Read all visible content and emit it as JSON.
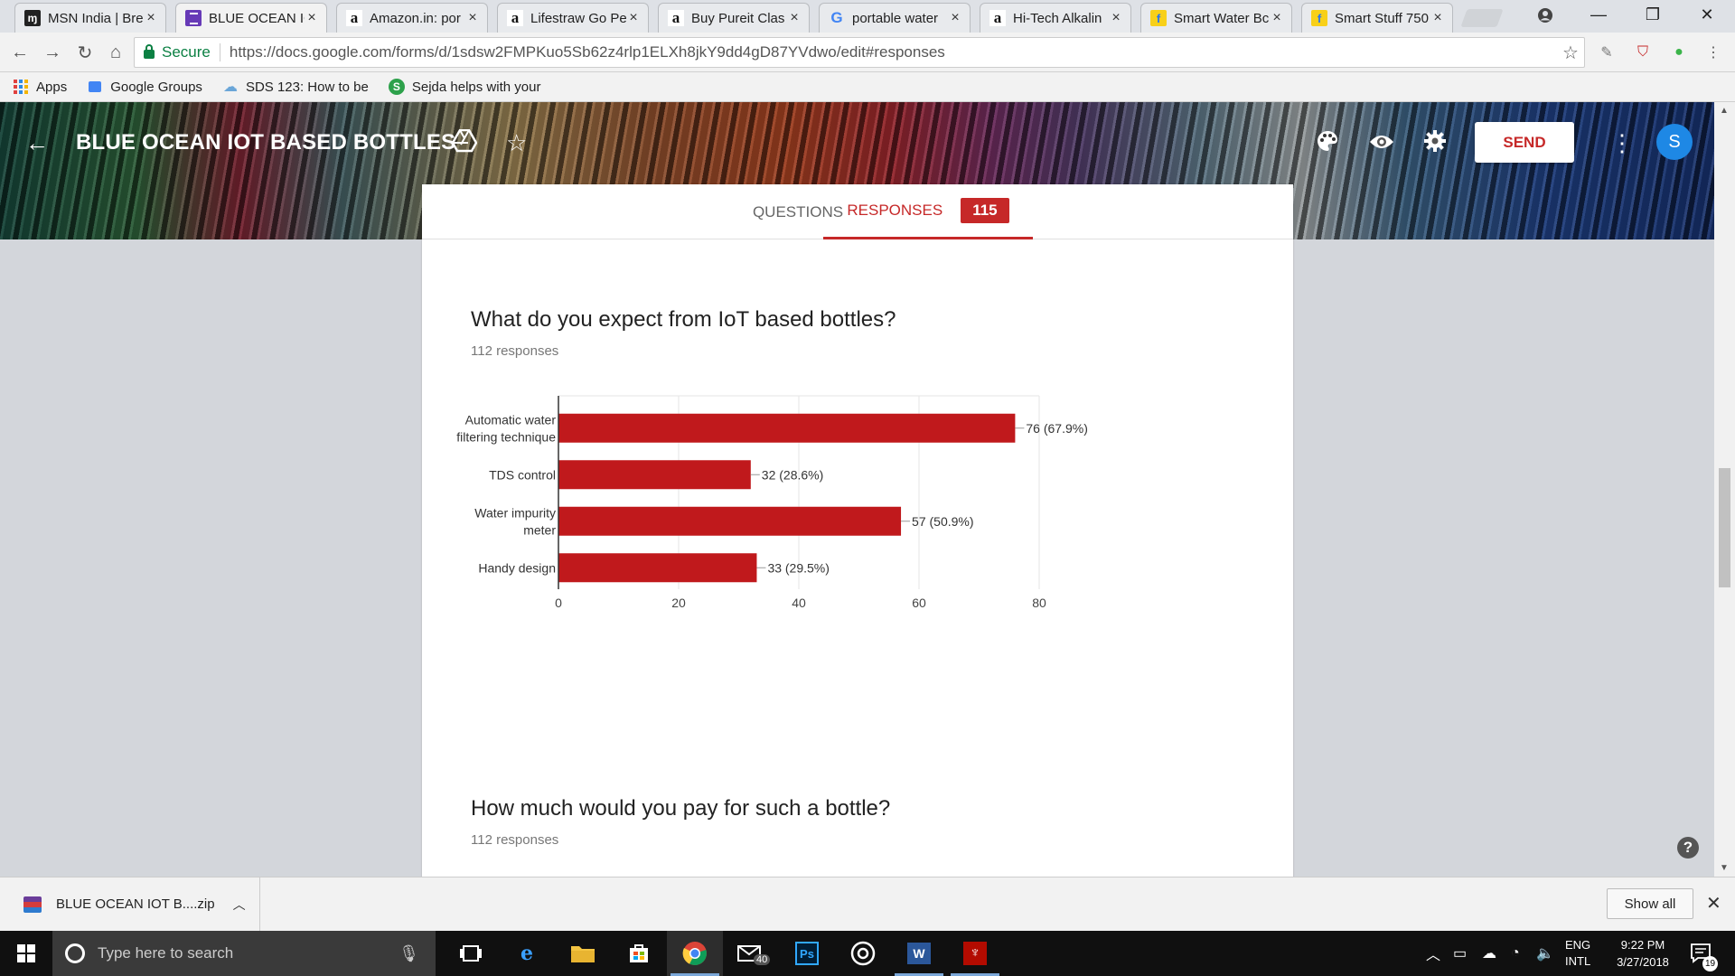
{
  "browser": {
    "tabs": [
      {
        "label": "MSN India | Bre",
        "icon": "msn-icon"
      },
      {
        "label": "BLUE OCEAN IC",
        "icon": "forms-icon"
      },
      {
        "label": "Amazon.in: por",
        "icon": "amazon-icon"
      },
      {
        "label": "Lifestraw Go Pe",
        "icon": "amazon-icon"
      },
      {
        "label": "Buy Pureit Clas",
        "icon": "amazon-icon"
      },
      {
        "label": "portable water",
        "icon": "google-icon"
      },
      {
        "label": "Hi-Tech Alkalin",
        "icon": "amazon-icon"
      },
      {
        "label": "Smart Water Bc",
        "icon": "flipkart-icon"
      },
      {
        "label": "Smart Stuff 750",
        "icon": "flipkart-icon"
      }
    ],
    "tab_close": "×",
    "secure_label": "Secure",
    "url": "https://docs.google.com/forms/d/1sdsw2FMPKuo5Sb62z4rlp1ELXh8jkY9dd4gD87YVdwo/edit#responses",
    "bookmarks": [
      {
        "label": "Apps"
      },
      {
        "label": "Google Groups"
      },
      {
        "label": "SDS 123: How to be"
      },
      {
        "label": "Sejda helps with your"
      }
    ]
  },
  "form": {
    "title": "BLUE OCEAN IOT BASED BOTTLES",
    "send_label": "SEND",
    "avatar_letter": "S",
    "tabs": {
      "questions": "QUESTIONS",
      "responses": "RESPONSES",
      "responses_count": "115"
    },
    "accent": "#c62828",
    "questions": [
      {
        "title": "What do you expect from IoT based bottles?",
        "responses": "112 responses"
      },
      {
        "title": "How much would you pay for such a bottle?",
        "responses": "112 responses"
      }
    ]
  },
  "chart_data": {
    "type": "bar",
    "orientation": "horizontal",
    "categories": [
      "Automatic water filtering technique",
      "TDS control",
      "Water impurity meter",
      "Handy design"
    ],
    "category_lines": [
      [
        "Automatic water",
        "filtering technique"
      ],
      [
        "TDS control"
      ],
      [
        "Water impurity",
        "meter"
      ],
      [
        "Handy design"
      ]
    ],
    "values": [
      76,
      32,
      57,
      33
    ],
    "data_labels": [
      "76 (67.9%)",
      "32 (28.6%)",
      "57 (50.9%)",
      "33 (29.5%)"
    ],
    "xlim": [
      0,
      80
    ],
    "ticks": [
      0,
      20,
      40,
      60,
      80
    ],
    "bar_color": "#c0191c",
    "grid": true
  },
  "downloads": {
    "file": "BLUE OCEAN IOT B....zip",
    "show_all": "Show all"
  },
  "taskbar": {
    "search_placeholder": "Type here to search",
    "mail_badge": "40",
    "lang_top": "ENG",
    "lang_bottom": "INTL",
    "time": "9:22 PM",
    "date": "3/27/2018",
    "notification_count": "19"
  }
}
